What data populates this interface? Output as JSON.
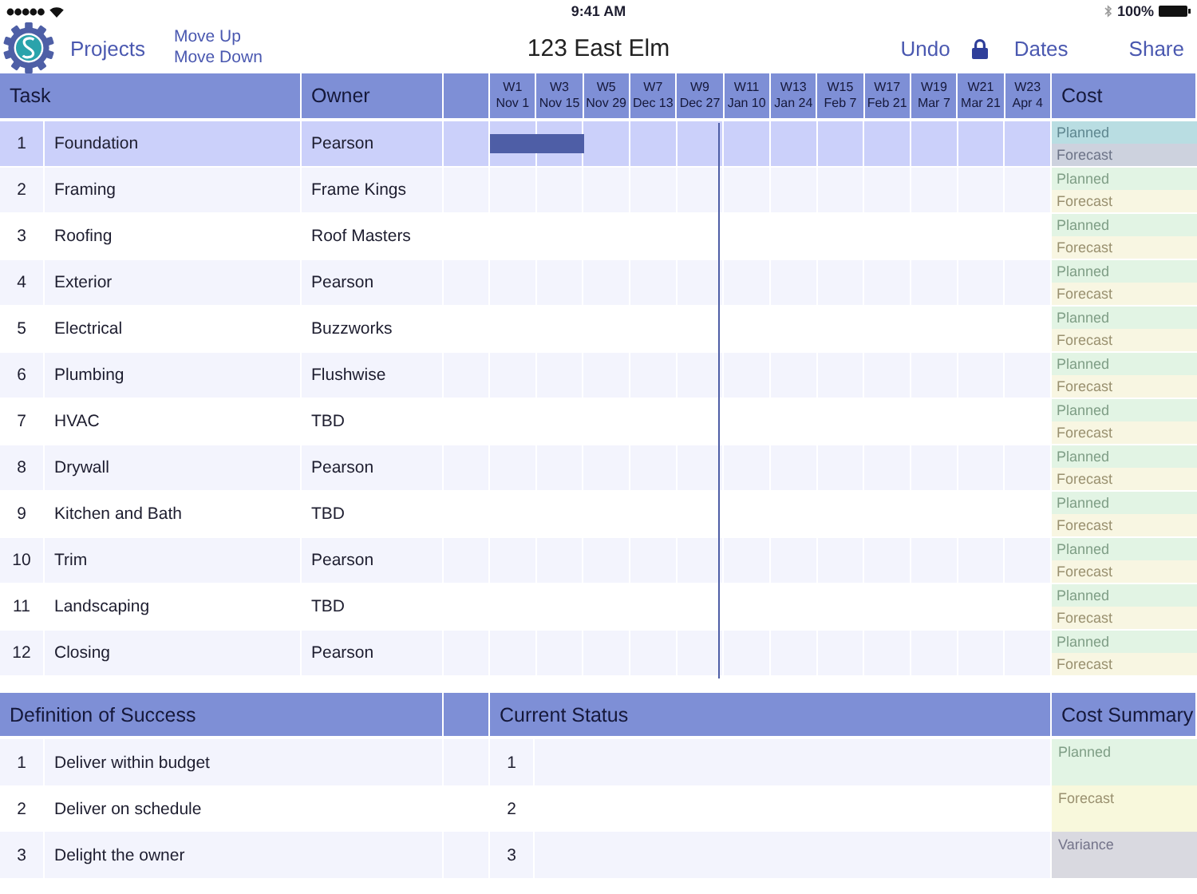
{
  "status_bar": {
    "time": "9:41 AM",
    "battery": "100%"
  },
  "toolbar": {
    "projects": "Projects",
    "move_up": "Move Up",
    "move_down": "Move Down",
    "title": "123 East Elm",
    "undo": "Undo",
    "locked": true,
    "dates": "Dates",
    "share": "Share"
  },
  "tasks_table": {
    "columns": {
      "task": "Task",
      "owner": "Owner",
      "cost": "Cost"
    },
    "weeks": [
      {
        "week": "W1",
        "date": "Nov 1"
      },
      {
        "week": "W3",
        "date": "Nov 15"
      },
      {
        "week": "W5",
        "date": "Nov 29"
      },
      {
        "week": "W7",
        "date": "Dec 13"
      },
      {
        "week": "W9",
        "date": "Dec 27"
      },
      {
        "week": "W11",
        "date": "Jan 10"
      },
      {
        "week": "W13",
        "date": "Jan 24"
      },
      {
        "week": "W15",
        "date": "Feb 7"
      },
      {
        "week": "W17",
        "date": "Feb 21"
      },
      {
        "week": "W19",
        "date": "Mar 7"
      },
      {
        "week": "W21",
        "date": "Mar 21"
      },
      {
        "week": "W23",
        "date": "Apr 4"
      }
    ],
    "rows": [
      {
        "number": "1",
        "task": "Foundation",
        "owner": "Pearson",
        "selected": true,
        "bar": {
          "level": 0.1667
        },
        "cost": {
          "planned": "Planned",
          "forecast": "Forecast"
        }
      },
      {
        "number": "2",
        "task": "Framing",
        "owner": "Frame Kings",
        "selected": false,
        "cost": {
          "planned": "Planned",
          "forecast": "Forecast"
        }
      },
      {
        "number": "3",
        "task": "Roofing",
        "owner": "Roof Masters",
        "selected": false,
        "cost": {
          "planned": "Planned",
          "forecast": "Forecast"
        }
      },
      {
        "number": "4",
        "task": "Exterior",
        "owner": "Pearson",
        "selected": false,
        "cost": {
          "planned": "Planned",
          "forecast": "Forecast"
        }
      },
      {
        "number": "5",
        "task": "Electrical",
        "owner": "Buzzworks",
        "selected": false,
        "cost": {
          "planned": "Planned",
          "forecast": "Forecast"
        }
      },
      {
        "number": "6",
        "task": "Plumbing",
        "owner": "Flushwise",
        "selected": false,
        "cost": {
          "planned": "Planned",
          "forecast": "Forecast"
        }
      },
      {
        "number": "7",
        "task": "HVAC",
        "owner": "TBD",
        "selected": false,
        "cost": {
          "planned": "Planned",
          "forecast": "Forecast"
        }
      },
      {
        "number": "8",
        "task": "Drywall",
        "owner": "Pearson",
        "selected": false,
        "cost": {
          "planned": "Planned",
          "forecast": "Forecast"
        }
      },
      {
        "number": "9",
        "task": "Kitchen and Bath",
        "owner": "TBD",
        "selected": false,
        "cost": {
          "planned": "Planned",
          "forecast": "Forecast"
        }
      },
      {
        "number": "10",
        "task": "Trim",
        "owner": "Pearson",
        "selected": false,
        "cost": {
          "planned": "Planned",
          "forecast": "Forecast"
        }
      },
      {
        "number": "11",
        "task": "Landscaping",
        "owner": "TBD",
        "selected": false,
        "cost": {
          "planned": "Planned",
          "forecast": "Forecast"
        }
      },
      {
        "number": "12",
        "task": "Closing",
        "owner": "Pearson",
        "selected": false,
        "cost": {
          "planned": "Planned",
          "forecast": "Forecast"
        }
      }
    ]
  },
  "success_table": {
    "columns": {
      "definition": "Definition of Success",
      "status": "Current Status",
      "cost_summary": "Cost Summary"
    },
    "rows": [
      {
        "number": "1",
        "definition": "Deliver within budget",
        "status": "1"
      },
      {
        "number": "2",
        "definition": "Deliver on schedule",
        "status": "2"
      },
      {
        "number": "3",
        "definition": "Delight the owner",
        "status": "3"
      }
    ],
    "cost_summary": [
      {
        "kind": "planned",
        "label": "Planned"
      },
      {
        "kind": "forecast",
        "label": "Forecast"
      },
      {
        "kind": "variance",
        "label": "Variance"
      }
    ]
  }
}
